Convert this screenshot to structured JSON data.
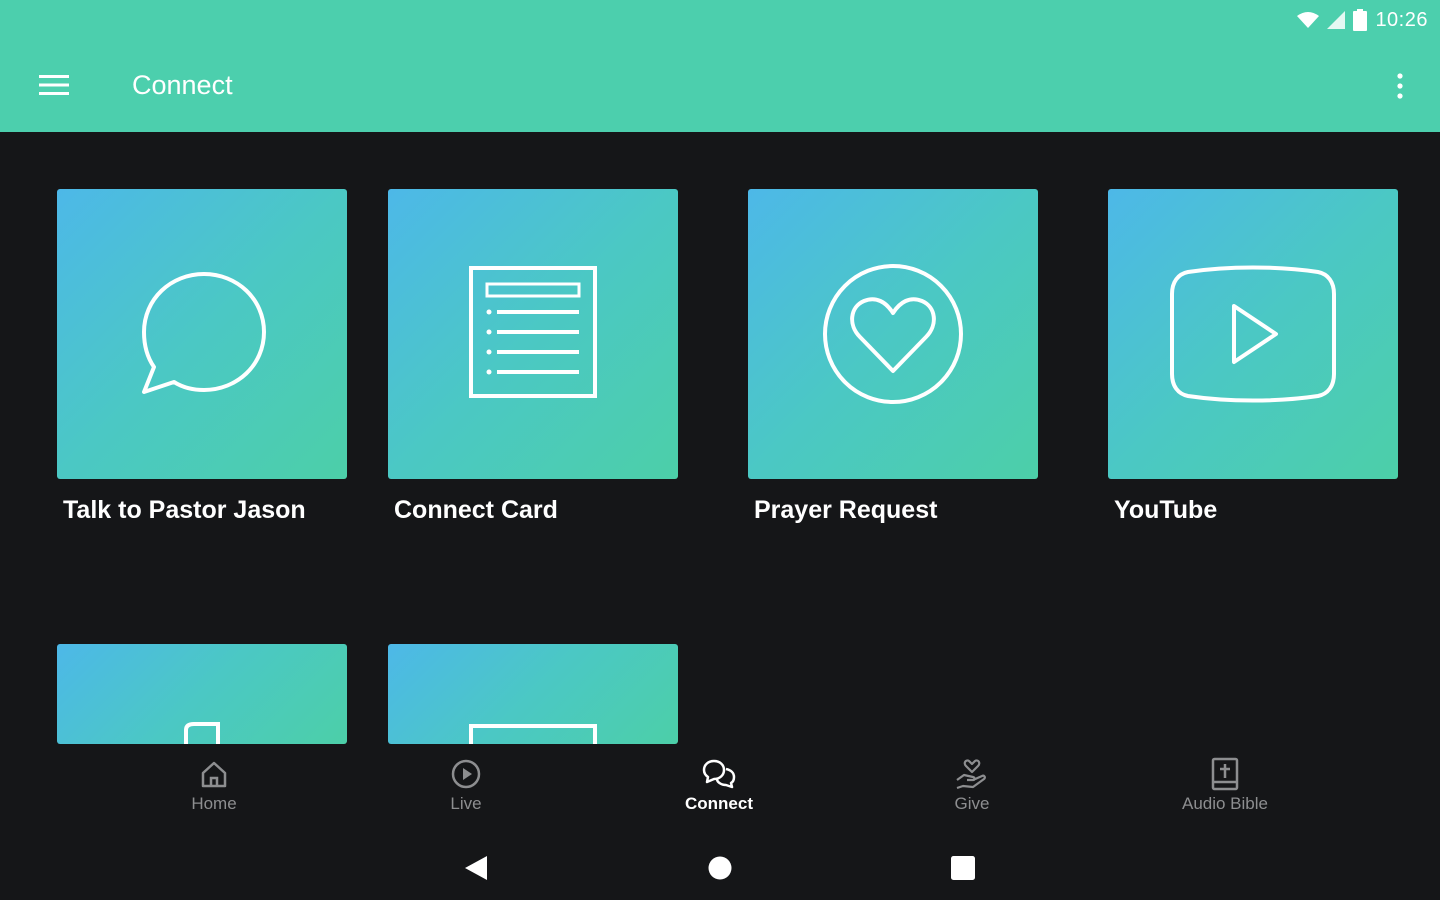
{
  "status_bar": {
    "time": "10:26"
  },
  "app_bar": {
    "title": "Connect"
  },
  "tiles": [
    {
      "label": "Talk to Pastor Jason",
      "icon": "chat-bubble-icon"
    },
    {
      "label": "Connect Card",
      "icon": "document-list-icon"
    },
    {
      "label": "Prayer Request",
      "icon": "heart-circle-icon"
    },
    {
      "label": "YouTube",
      "icon": "play-video-icon"
    }
  ],
  "bottom_nav": {
    "items": [
      {
        "label": "Home",
        "icon": "home-icon",
        "active": false
      },
      {
        "label": "Live",
        "icon": "play-circle-icon",
        "active": false
      },
      {
        "label": "Connect",
        "icon": "chat-bubbles-icon",
        "active": true
      },
      {
        "label": "Give",
        "icon": "giving-hand-icon",
        "active": false
      },
      {
        "label": "Audio Bible",
        "icon": "bible-icon",
        "active": false
      }
    ]
  },
  "colors": {
    "accent": "#4ccfad",
    "background": "#151618",
    "tile_gradient_start": "#4db8e8",
    "tile_gradient_end": "#4ccfa8",
    "inactive_nav": "#8d8e90"
  }
}
